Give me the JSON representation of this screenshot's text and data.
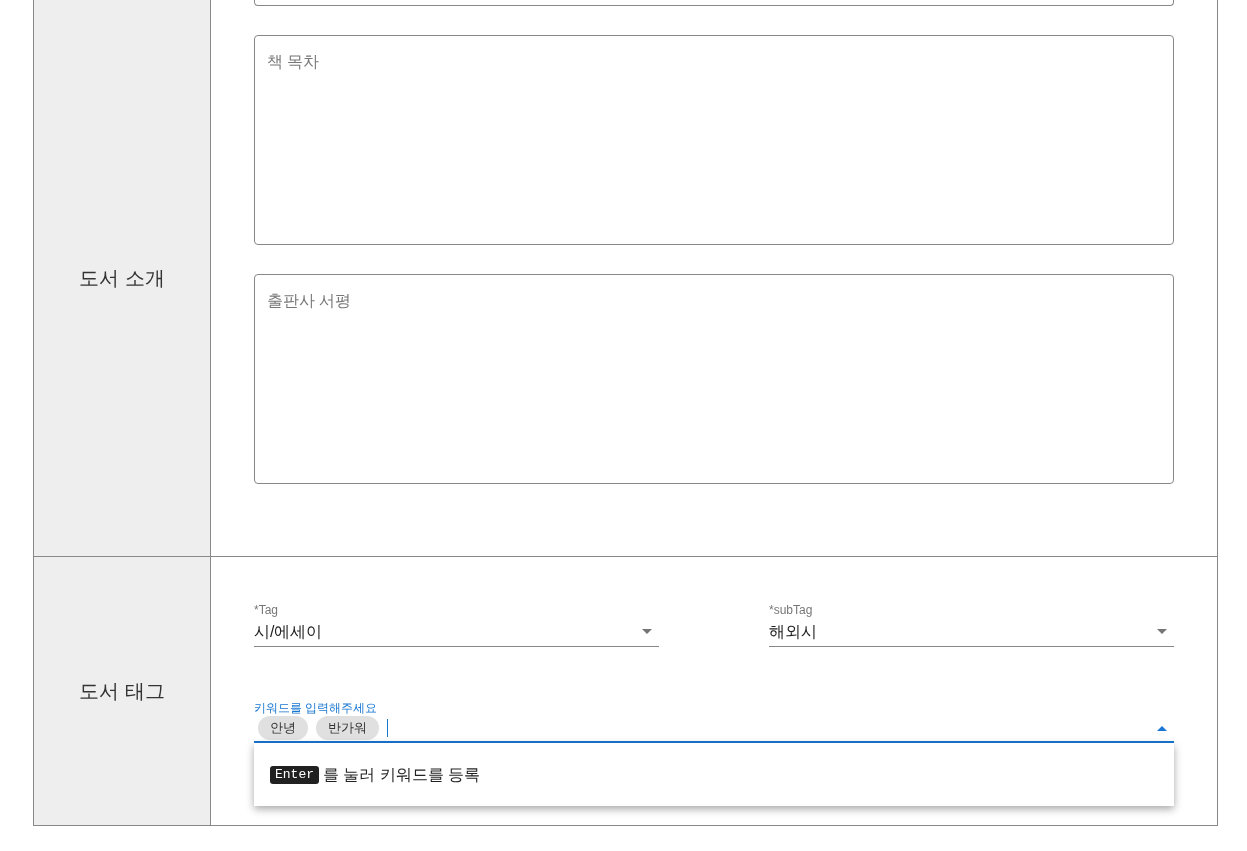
{
  "sections": [
    {
      "kind": "textareas",
      "label": "도서 소개",
      "fields": [
        {
          "placeholder": "책 목차"
        },
        {
          "placeholder": "출판사 서평"
        }
      ]
    },
    {
      "kind": "tags",
      "label": "도서 태그",
      "selects": [
        {
          "label": "*Tag",
          "value": "시/에세이"
        },
        {
          "label": "*subTag",
          "value": "해외시"
        }
      ],
      "keywords": {
        "label": "키워드를 입력해주세요",
        "chips": [
          "안녕",
          "반가워"
        ],
        "expanded": true
      },
      "menu": {
        "key": "Enter",
        "text": "를 눌러 키워드를 등록"
      }
    }
  ]
}
